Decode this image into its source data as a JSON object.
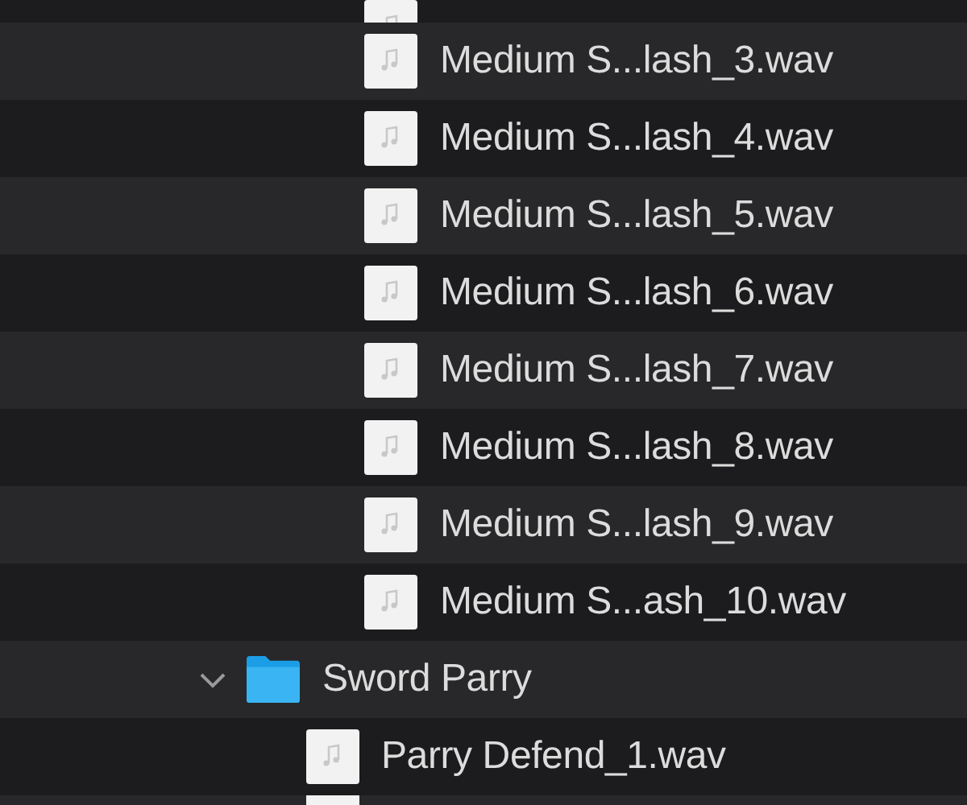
{
  "tree": [
    {
      "children": [
        {
          "children": [
            {
              "name": "Medium S...lash_3.wav",
              "kind": "file"
            },
            {
              "name": "Medium S...lash_4.wav",
              "kind": "file"
            },
            {
              "name": "Medium S...lash_5.wav",
              "kind": "file"
            },
            {
              "name": "Medium S...lash_6.wav",
              "kind": "file"
            },
            {
              "name": "Medium S...lash_7.wav",
              "kind": "file"
            },
            {
              "name": "Medium S...lash_8.wav",
              "kind": "file"
            },
            {
              "name": "Medium S...lash_9.wav",
              "kind": "file"
            },
            {
              "name": "Medium S...ash_10.wav",
              "kind": "file"
            }
          ]
        }
      ]
    },
    {
      "name": "Sword Parry",
      "kind": "folder",
      "expanded": true,
      "children": [
        {
          "name": "Parry Defend_1.wav",
          "kind": "file"
        }
      ]
    }
  ]
}
